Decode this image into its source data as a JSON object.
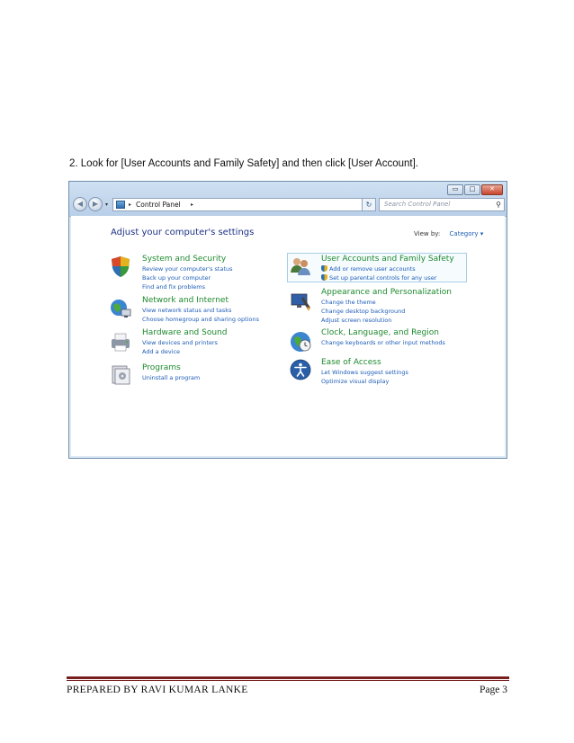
{
  "instruction": "2. Look for [User Accounts and Family Safety] and then click [User Account].",
  "window": {
    "buttons": {
      "minimize": "▭",
      "maximize": "□",
      "close": "✕"
    },
    "nav": {
      "back": "◀",
      "forward": "▶",
      "dropdown": "▾"
    },
    "address": {
      "separator": "▸",
      "location": "Control Panel",
      "dropdown": "▾"
    },
    "refresh": "↻",
    "search": {
      "placeholder": "Search Control Panel",
      "icon": "⚲"
    },
    "heading": "Adjust your computer's settings",
    "view_by": {
      "label": "View by:",
      "value": "Category ▾"
    },
    "categories": [
      {
        "title": "System and Security",
        "icon": "shield-icon",
        "links": [
          "Review your computer's status",
          "Back up your computer",
          "Find and fix problems"
        ]
      },
      {
        "title": "Network and Internet",
        "icon": "network-icon",
        "links": [
          "View network status and tasks",
          "Choose homegroup and sharing options"
        ]
      },
      {
        "title": "Hardware and Sound",
        "icon": "printer-icon",
        "links": [
          "View devices and printers",
          "Add a device"
        ]
      },
      {
        "title": "Programs",
        "icon": "programs-icon",
        "links": [
          "Uninstall a program"
        ]
      },
      {
        "title": "User Accounts and Family Safety",
        "icon": "users-icon",
        "links": [
          "Add or remove user accounts",
          "Set up parental controls for any user"
        ]
      },
      {
        "title": "Appearance and Personalization",
        "icon": "appearance-icon",
        "links": [
          "Change the theme",
          "Change desktop background",
          "Adjust screen resolution"
        ]
      },
      {
        "title": "Clock, Language, and Region",
        "icon": "globe-clock-icon",
        "links": [
          "Change keyboards or other input methods"
        ]
      },
      {
        "title": "Ease of Access",
        "icon": "ease-of-access-icon",
        "links": [
          "Let Windows suggest settings",
          "Optimize visual display"
        ]
      }
    ]
  },
  "footer": {
    "left": "PREPARED BY RAVI KUMAR LANKE",
    "right": "Page 3"
  },
  "colors": {
    "category_title": "#1e8a2e",
    "link": "#1e5db8",
    "heading": "#1e3287",
    "highlight": "#f7f77a",
    "footer_rule": "#7a1f1f"
  }
}
